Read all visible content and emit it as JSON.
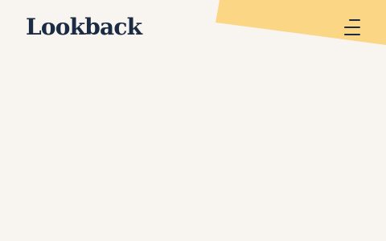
{
  "header": {
    "logo_text": "Lookback",
    "menu_icon": "hamburger-menu-icon"
  },
  "theme": {
    "background": "#f8f5f0",
    "accent": "#fbd685",
    "brand": "#1c2b44"
  }
}
